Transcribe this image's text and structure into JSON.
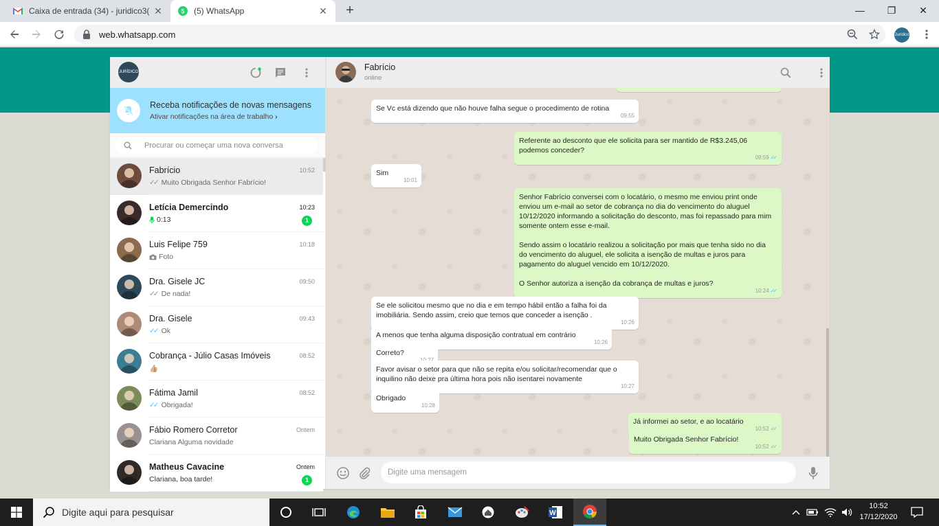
{
  "browser": {
    "tabs": [
      {
        "title": "Caixa de entrada (34) - juridico3(",
        "favicon": "gmail-icon",
        "active": false
      },
      {
        "title": "(5) WhatsApp",
        "favicon": "whatsapp-icon",
        "active": true
      }
    ],
    "url": "web.whatsapp.com",
    "profile_label": "Jurídico"
  },
  "sidebar": {
    "my_avatar_label": "JURÍDICO",
    "notification": {
      "title": "Receba notificações de novas mensagens",
      "subtitle": "Ativar notificações na área de trabalho",
      "chevron": "›"
    },
    "search_placeholder": "Procurar ou começar uma nova conversa",
    "chats": [
      {
        "name": "Fabrício",
        "time": "10:52",
        "preview": "Muito Obrigada Senhor Fabrício!",
        "ticks": "✓✓",
        "bold": false,
        "unread": "",
        "selected": true,
        "avatar_color": "#6d4c3d"
      },
      {
        "name": "Letícia Demercindo",
        "time": "10:23",
        "preview": "0:13",
        "mic": true,
        "bold": true,
        "unread": "1",
        "selected": false,
        "avatar_color": "#3a2b2b"
      },
      {
        "name": "Luis Felipe 759",
        "time": "10:18",
        "preview": "Foto",
        "camera": true,
        "bold": false,
        "unread": "",
        "selected": false,
        "avatar_color": "#8b6b4e"
      },
      {
        "name": "Dra. Gisele JC",
        "time": "09:50",
        "preview": "De nada!",
        "ticks": "✓✓",
        "bold": false,
        "unread": "",
        "selected": false,
        "avatar_color": "#2e4a5a"
      },
      {
        "name": "Dra. Gisele",
        "time": "09:43",
        "preview": "Ok",
        "ticks": "✓✓",
        "blue": true,
        "bold": false,
        "unread": "",
        "selected": false,
        "avatar_color": "#b08a78"
      },
      {
        "name": "Cobrança - Júlio Casas Imóveis",
        "time": "08:52",
        "preview": "👍🏼",
        "bold": false,
        "unread": "",
        "selected": false,
        "avatar_color": "#3b7d92"
      },
      {
        "name": "Fátima Jamil",
        "time": "08:52",
        "preview": "Obrigada!",
        "ticks": "✓✓",
        "blue": true,
        "bold": false,
        "unread": "",
        "selected": false,
        "avatar_color": "#7c8c5a"
      },
      {
        "name": "Fábio Romero Corretor",
        "time": "Ontem",
        "preview": "Clariana  Alguma novidade",
        "bold": false,
        "unread": "",
        "selected": false,
        "avatar_color": "#9a9290"
      },
      {
        "name": "Matheus Cavacine",
        "time": "Ontem",
        "preview": "Clariana, boa tarde!",
        "bold": true,
        "unread": "1",
        "selected": false,
        "avatar_color": "#2f2a28"
      }
    ]
  },
  "conversation": {
    "contact_name": "Fabrício",
    "contact_status": "online",
    "composer_placeholder": "Digite uma mensagem",
    "messages": [
      {
        "dir": "out",
        "text": "",
        "time": "09:50",
        "ticks": "✓✓"
      },
      {
        "dir": "in",
        "text": "Se Vc está dizendo que não houve falha segue o procedimento de rotina",
        "time": "09:55"
      },
      {
        "dir": "out",
        "text": "Referente ao desconto que ele solicita para ser mantido de R$3.245,06\npodemos conceder?",
        "time": "09:59",
        "ticks": "✓✓"
      },
      {
        "dir": "in",
        "text": "Sim",
        "time": "10:01"
      },
      {
        "dir": "out",
        "text": "Senhor Fabrício conversei com o locatário, o mesmo me enviou print onde\nenviou um e-mail ao setor de cobrança no dia do vencimento do aluguel\n10/12/2020 informando a solicitação do desconto, mas foi repassado para mim\nsomente ontem esse e-mail.\n\nSendo assim o locatário realizou a solicitação por mais que tenha sido no dia\ndo vencimento do aluguel, ele solicita a isenção de multas e juros para\npagamento do aluguel vencido em 10/12/2020.\n\nO Senhor autoriza a isenção da cobrança de multas e juros?",
        "time": "10:24",
        "ticks": "✓✓"
      },
      {
        "dir": "in",
        "text": "Se ele solicitou mesmo que no dia e em tempo hábil então a falha foi da\nimobiliária. Sendo assim, creio que temos que conceder a isenção .",
        "time": "10:26"
      },
      {
        "dir": "in",
        "text": "A menos que tenha alguma disposição contratual em contrário",
        "time": "10:26"
      },
      {
        "dir": "in",
        "text": "Correto?",
        "time": "10:27"
      },
      {
        "dir": "in",
        "text": "Favor avisar o setor para que não se repita e/ou solicitar/recomendar que o\ninquilino não deixe pra última hora pois não isentarei novamente",
        "time": "10:27"
      },
      {
        "dir": "in",
        "text": "Obrigado",
        "time": "10:28"
      },
      {
        "dir": "out",
        "text": "Já informei ao setor, e ao locatário",
        "time": "10:52",
        "ticks": "✓✓"
      },
      {
        "dir": "out",
        "text": "Muito Obrigada Senhor Fabrício!",
        "time": "10:52",
        "ticks": "✓✓"
      }
    ]
  },
  "taskbar": {
    "search_placeholder": "Digite aqui para pesquisar",
    "time": "10:52",
    "date": "17/12/2020"
  },
  "colors": {
    "teal": "#009688",
    "out_bubble": "#dcf8c6",
    "badge_green": "#06d755",
    "notif_blue": "#9de1fe"
  }
}
